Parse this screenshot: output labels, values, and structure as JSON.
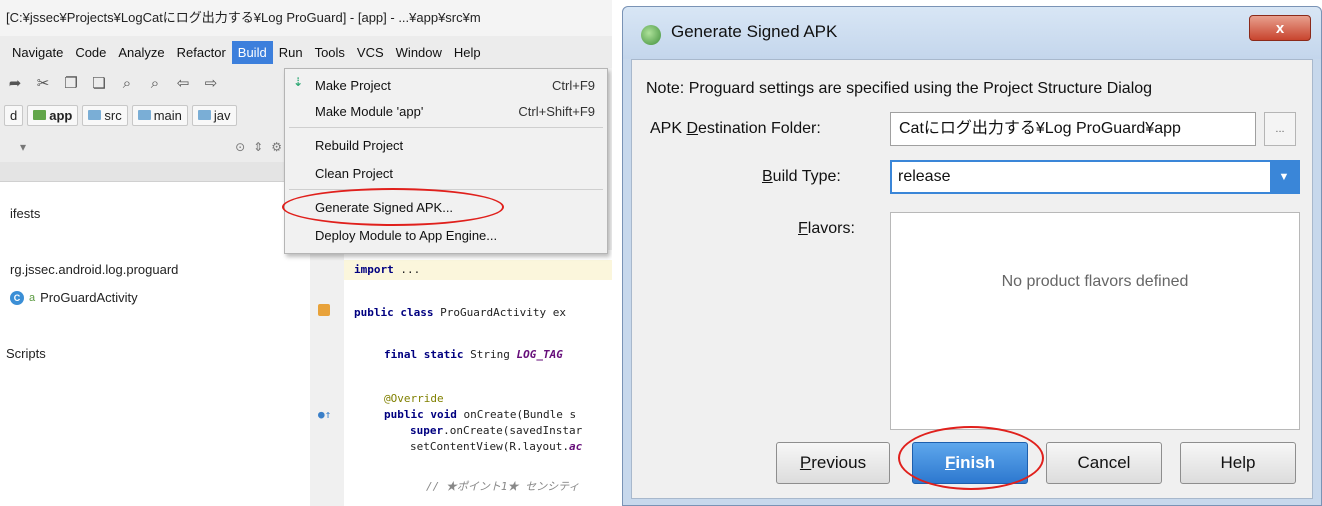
{
  "ide": {
    "title": "[C:¥jssec¥Projects¥LogCatにログ出力する¥Log ProGuard] - [app] - ...¥app¥src¥m",
    "menu": [
      "Navigate",
      "Code",
      "Analyze",
      "Refactor",
      "Build",
      "Run",
      "Tools",
      "VCS",
      "Window",
      "Help"
    ],
    "breadcrumb": [
      "d",
      "app",
      "src",
      "main",
      "jav"
    ],
    "tree": [
      "ifests",
      "rg.jssec.android.log.proguard",
      "ProGuardActivity",
      "Scripts"
    ],
    "build_menu": [
      {
        "label": "Make Project",
        "shortcut": "Ctrl+F9"
      },
      {
        "label": "Make Module 'app'",
        "shortcut": "Ctrl+Shift+F9"
      },
      {
        "label": "Rebuild Project",
        "shortcut": ""
      },
      {
        "label": "Clean Project",
        "shortcut": ""
      },
      {
        "label": "Generate Signed APK...",
        "shortcut": ""
      },
      {
        "label": "Deploy Module to App Engine...",
        "shortcut": ""
      }
    ],
    "code": {
      "import_kw": "import",
      "import_rest": " ...",
      "public_class": "public class",
      "class_rest": " ProGuardActivity ex",
      "final_static": "final static",
      "string_kw": " String ",
      "log_tag": "LOG_TAG",
      "override": "@Override",
      "public_void": "public void",
      "oncreate_rest": " onCreate(Bundle s",
      "super_kw": "super",
      "super_rest": ".onCreate(savedInstar",
      "setcontent_rest": "setContentView(R.layout.",
      "setcontent_tail": "ac",
      "comment": "// ★ポイント1★ センシティ"
    }
  },
  "dialog": {
    "title": "Generate Signed APK",
    "close_label": "x",
    "note": "Note: Proguard settings are specified using the Project Structure Dialog",
    "apk_label_pre": "APK ",
    "apk_label_u": "D",
    "apk_label_post": "estination Folder:",
    "apk_value": "Catにログ出力する¥Log ProGuard¥app",
    "browse_label": "...",
    "build_type_label_u": "B",
    "build_type_label_post": "uild Type:",
    "build_type_value": "release",
    "flavors_label_u": "F",
    "flavors_label_post": "lavors:",
    "flavors_empty": "No product flavors defined",
    "buttons": {
      "previous_u": "P",
      "previous_rest": "revious",
      "finish_u": "F",
      "finish_rest": "inish",
      "cancel": "Cancel",
      "help": "Help"
    }
  }
}
